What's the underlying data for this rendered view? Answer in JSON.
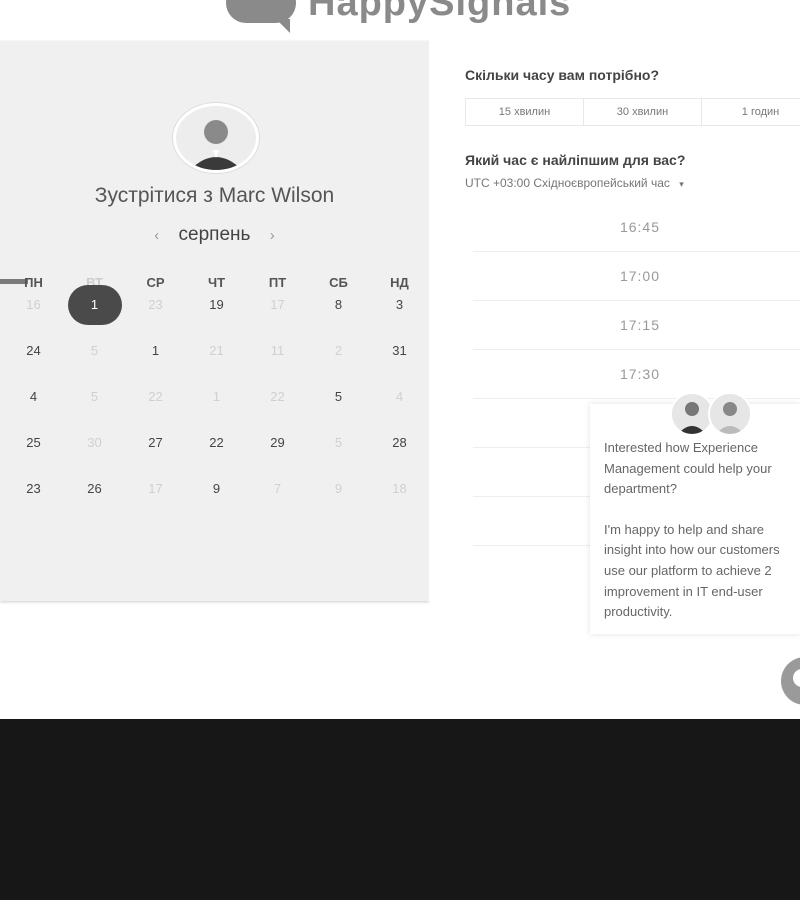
{
  "brand": {
    "logo_text": "HappySignals"
  },
  "scheduler": {
    "host_title": "Зустрітися з Marc Wilson",
    "month_label": "серпень",
    "prev_icon": "chevron-left-icon",
    "next_icon": "chevron-right-icon",
    "weekdays": [
      "ПН",
      "ВТ",
      "СР",
      "ЧТ",
      "ПТ",
      "СБ",
      "НД"
    ],
    "weeks": [
      [
        {
          "d": "16",
          "s": "off"
        },
        {
          "d": "1",
          "s": "sel"
        },
        {
          "d": "23",
          "s": "off"
        },
        {
          "d": "19",
          "s": "on"
        },
        {
          "d": "17",
          "s": "off"
        },
        {
          "d": "8",
          "s": "on"
        },
        {
          "d": "3",
          "s": "on"
        }
      ],
      [
        {
          "d": "24",
          "s": "on"
        },
        {
          "d": "5",
          "s": "off"
        },
        {
          "d": "1",
          "s": "on"
        },
        {
          "d": "21",
          "s": "off"
        },
        {
          "d": "11",
          "s": "off"
        },
        {
          "d": "2",
          "s": "off"
        },
        {
          "d": "31",
          "s": "on"
        }
      ],
      [
        {
          "d": "4",
          "s": "on"
        },
        {
          "d": "5",
          "s": "off"
        },
        {
          "d": "22",
          "s": "off"
        },
        {
          "d": "1",
          "s": "off"
        },
        {
          "d": "22",
          "s": "off"
        },
        {
          "d": "5",
          "s": "on"
        },
        {
          "d": "4",
          "s": "off"
        }
      ],
      [
        {
          "d": "25",
          "s": "on"
        },
        {
          "d": "30",
          "s": "off"
        },
        {
          "d": "27",
          "s": "on"
        },
        {
          "d": "22",
          "s": "on"
        },
        {
          "d": "29",
          "s": "on"
        },
        {
          "d": "5",
          "s": "off"
        },
        {
          "d": "28",
          "s": "on"
        }
      ],
      [
        {
          "d": "23",
          "s": "on"
        },
        {
          "d": "26",
          "s": "on"
        },
        {
          "d": "17",
          "s": "off"
        },
        {
          "d": "9",
          "s": "on"
        },
        {
          "d": "7",
          "s": "off"
        },
        {
          "d": "9",
          "s": "off"
        },
        {
          "d": "18",
          "s": "off"
        }
      ]
    ]
  },
  "booking": {
    "duration_question": "Скільки часу вам потрібно?",
    "durations": [
      "15 хвилин",
      "30 хвилин",
      "1 годин"
    ],
    "time_question": "Який час є найліпшим для вас?",
    "timezone": "UTC +03:00 Східноєвропейський час",
    "timezone_icon": "caret-down-icon",
    "slots": [
      "16:45",
      "17:00",
      "17:15",
      "17:30",
      "",
      "",
      ""
    ]
  },
  "chat": {
    "message_1": "Interested how Experience Management could help your department?",
    "message_2": "I'm happy to help and share insight into how our customers use our platform to achieve 2 improvement in IT end-user productivity.",
    "launcher_icon": "chat-bubble-icon"
  },
  "colors": {
    "selected_day": "#4a4a4a",
    "footer": "#171717",
    "panel": "#f0f0f0"
  }
}
